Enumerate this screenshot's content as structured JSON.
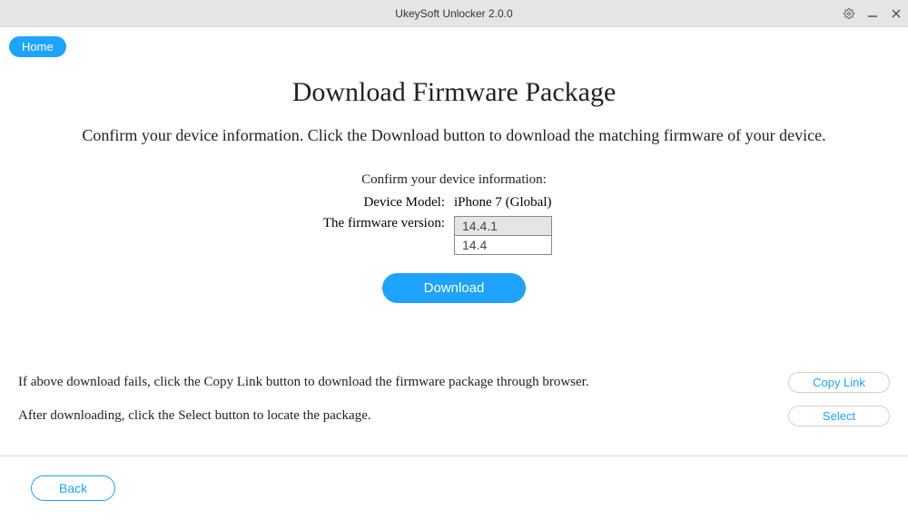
{
  "titlebar": {
    "title": "UkeySoft Unlocker 2.0.0"
  },
  "nav": {
    "home_label": "Home"
  },
  "main": {
    "page_title": "Download Firmware Package",
    "subtitle": "Confirm your device information. Click the Download button to download the matching firmware of your device.",
    "confirm_label": "Confirm your device information:",
    "device_model_label": "Device Model:",
    "device_model_value": "iPhone 7 (Global)",
    "firmware_version_label": "The firmware version:",
    "firmware_options": {
      "selected": "14.4.1",
      "option2": "14.4"
    },
    "download_label": "Download"
  },
  "bottom": {
    "copy_text": "If above download fails, click the Copy Link button to download the firmware package through browser.",
    "copy_label": "Copy Link",
    "select_text": "After downloading, click the Select button to locate the package.",
    "select_label": "Select"
  },
  "footer": {
    "back_label": "Back"
  }
}
